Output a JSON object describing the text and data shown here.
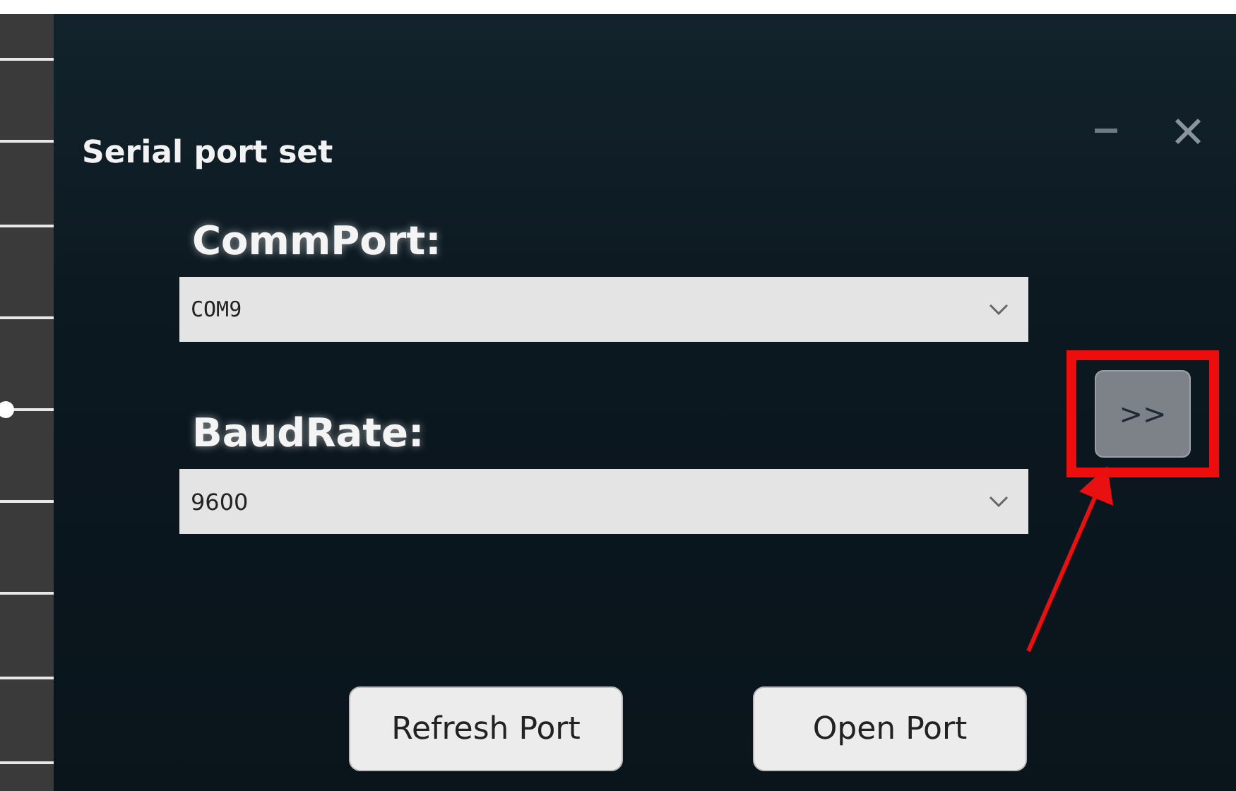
{
  "window": {
    "title": "Serial port set"
  },
  "fields": [
    {
      "label": "CommPort:",
      "value": "COM9"
    },
    {
      "label": "BaudRate:",
      "value": "9600"
    }
  ],
  "side_button": {
    "label": ">>",
    "highlighted": true
  },
  "buttons": [
    "Refresh Port",
    "Open Port"
  ]
}
